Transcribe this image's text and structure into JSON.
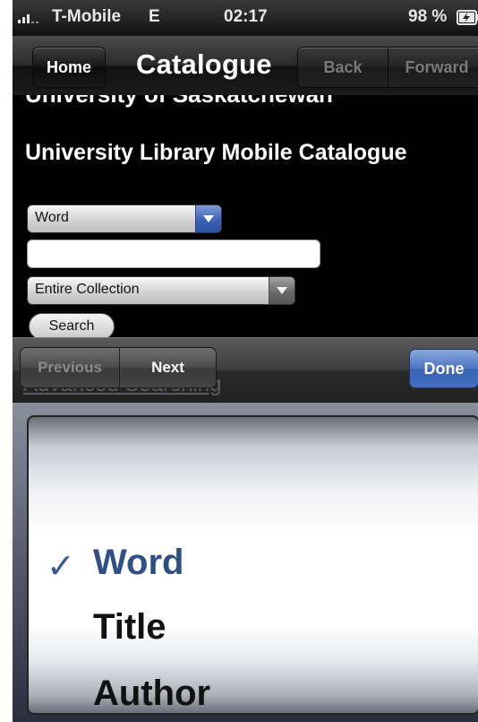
{
  "status_bar": {
    "carrier": "T-Mobile",
    "network": "E",
    "time": "02:17",
    "battery": "98 %"
  },
  "nav_bar": {
    "home_label": "Home",
    "title": "Catalogue",
    "back_label": "Back",
    "forward_label": "Forward"
  },
  "content": {
    "partial_heading": "University of Saskatchewan",
    "heading": "University Library Mobile Catalogue",
    "search_type_value": "Word",
    "search_input_value": "",
    "collection_value": "Entire Collection",
    "search_button_label": "Search",
    "advanced_link_label": "Advanced Searching"
  },
  "accessory_bar": {
    "previous_label": "Previous",
    "next_label": "Next",
    "done_label": "Done"
  },
  "picker": {
    "options": [
      {
        "label": "Word",
        "selected": true
      },
      {
        "label": "Title",
        "selected": false
      },
      {
        "label": "Author",
        "selected": false
      }
    ],
    "check_mark": "✓"
  },
  "colors": {
    "accent_blue": "#3c62b7",
    "done_blue": "#4c74c2",
    "selected_text": "#2f4f86"
  }
}
